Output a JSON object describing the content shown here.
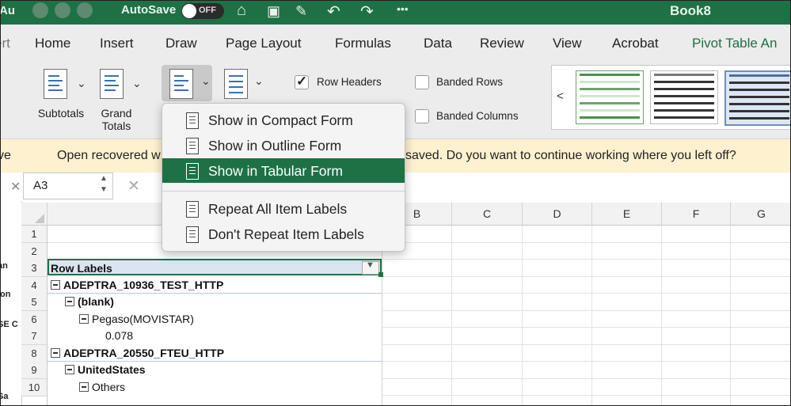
{
  "title_bar": {
    "left_clip": "Au",
    "autosave_label": "AutoSave",
    "autosave_state": "OFF",
    "workbook_name": "Book8",
    "overflow": "•••"
  },
  "tabs": [
    {
      "label": "ert"
    },
    {
      "label": "Home"
    },
    {
      "label": "Insert"
    },
    {
      "label": "Draw"
    },
    {
      "label": "Page Layout"
    },
    {
      "label": "Formulas"
    },
    {
      "label": "Data"
    },
    {
      "label": "Review"
    },
    {
      "label": "View"
    },
    {
      "label": "Acrobat"
    },
    {
      "label": "Pivot Table An"
    }
  ],
  "ribbon": {
    "subtotals": "Subtotals",
    "grand_totals_1": "Grand",
    "grand_totals_2": "Totals",
    "row_headers": "Row Headers",
    "row_headers_checked": true,
    "banded_rows": "Banded Rows",
    "banded_columns": "Banded Columns",
    "gallery_prev": "<"
  },
  "message_bar": {
    "left_clip": "ve",
    "text_left": "Open recovered w",
    "text_right": "saved. Do you want to continue working where you left off?"
  },
  "formula_bar": {
    "name_box": "A3",
    "cancel_icon": "✕"
  },
  "grid": {
    "columns": [
      "B",
      "C",
      "D",
      "E",
      "F",
      "G"
    ],
    "row_numbers": [
      "1",
      "2",
      "3",
      "4",
      "5",
      "6",
      "7",
      "8",
      "9",
      "10"
    ],
    "side_clips": [
      "an",
      "ion",
      "SE C",
      "Sa"
    ],
    "rows": [
      {
        "row": "3",
        "text": "Row Labels"
      },
      {
        "row": "4",
        "text": "ADEPTRA_10936_TEST_HTTP"
      },
      {
        "row": "5",
        "text": "(blank)"
      },
      {
        "row": "6",
        "text": "Pegaso(MOVISTAR)"
      },
      {
        "row": "7",
        "text": "0.078"
      },
      {
        "row": "8",
        "text": "ADEPTRA_20550_FTEU_HTTP"
      },
      {
        "row": "9",
        "text": "UnitedStates"
      },
      {
        "row": "10",
        "text": "Others"
      }
    ]
  },
  "layout_menu": {
    "items": [
      {
        "label": "Show in Compact Form"
      },
      {
        "label": "Show in Outline Form"
      },
      {
        "label": "Show in Tabular Form"
      },
      {
        "label": "Repeat All Item Labels"
      },
      {
        "label": "Don't Repeat Item Labels"
      }
    ],
    "selected": "Show in Tabular Form"
  },
  "colors": {
    "accent": "#1e7145",
    "message_bar": "#fdf1cf"
  }
}
